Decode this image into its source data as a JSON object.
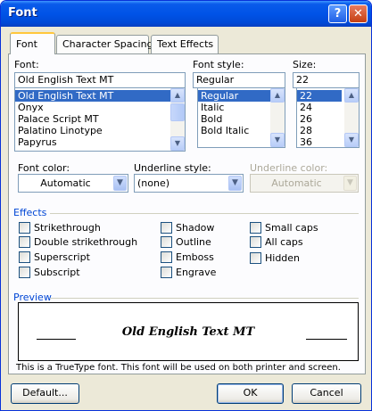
{
  "window": {
    "title": "Font",
    "help_label": "?",
    "close_label": "✕"
  },
  "tabs": [
    "Font",
    "Character Spacing",
    "Text Effects"
  ],
  "font": {
    "label": "Font:",
    "value": "Old English Text MT",
    "items": [
      "Old English Text MT",
      "Onyx",
      "Palace Script MT",
      "Palatino Linotype",
      "Papyrus"
    ]
  },
  "style": {
    "label": "Font style:",
    "value": "Regular",
    "items": [
      "Regular",
      "Italic",
      "Bold",
      "Bold Italic"
    ]
  },
  "size": {
    "label": "Size:",
    "value": "22",
    "items": [
      "22",
      "24",
      "26",
      "28",
      "36"
    ]
  },
  "font_color": {
    "label": "Font color:",
    "value": "Automatic"
  },
  "underline_style": {
    "label": "Underline style:",
    "value": "(none)"
  },
  "underline_color": {
    "label": "Underline color:",
    "value": "Automatic"
  },
  "effects": {
    "label": "Effects",
    "col1": [
      "Strikethrough",
      "Double strikethrough",
      "Superscript",
      "Subscript"
    ],
    "col2": [
      "Shadow",
      "Outline",
      "Emboss",
      "Engrave"
    ],
    "col3": [
      "Small caps",
      "All caps",
      "Hidden"
    ]
  },
  "preview": {
    "label": "Preview",
    "sample": "Old English Text MT"
  },
  "info_text": "This is a TrueType font. This font will be used on both printer and screen.",
  "buttons": {
    "default": "Default...",
    "ok": "OK",
    "cancel": "Cancel"
  },
  "colors": {
    "titlebar": "#0053e7",
    "selection": "#316ac5",
    "tab_highlight": "#ffc73c",
    "dialog_bg": "#ece9d8"
  }
}
